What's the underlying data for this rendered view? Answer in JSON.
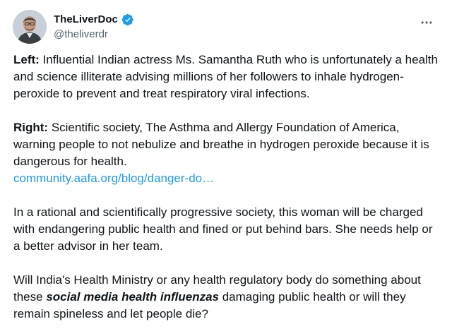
{
  "author": {
    "display_name": "TheLiverDoc",
    "handle": "@theliverdr",
    "verified": true,
    "avatar_icon": "person-avatar"
  },
  "actions": {
    "more_icon": "more-horizontal-icon"
  },
  "tweet": {
    "para1": {
      "lead": "Left:",
      "text": " Influential Indian actress Ms. Samantha Ruth who is unfortunately a health and science illiterate advising millions of her followers to inhale hydrogen-peroxide to prevent and treat respiratory viral infections."
    },
    "para2": {
      "lead": "Right:",
      "text": " Scientific society, The Asthma and Allergy Foundation of America, warning people to not nebulize and breathe in hydrogen peroxide because it is dangerous for health.",
      "link": "community.aafa.org/blog/danger-do…"
    },
    "para3": {
      "text": "In a rational and scientifically progressive society, this woman will be charged with endangering public health and fined or put behind bars. She needs help or a better advisor in her team."
    },
    "para4": {
      "before": "Will India's Health Ministry or any health regulatory body do something about these ",
      "emphasis": "social media health influenzas",
      "after": " damaging public health or will they remain spineless and let people die?"
    }
  },
  "colors": {
    "text": "#0f1419",
    "secondary": "#536471",
    "link": "#1d9bf0",
    "verified": "#1d9bf0"
  }
}
